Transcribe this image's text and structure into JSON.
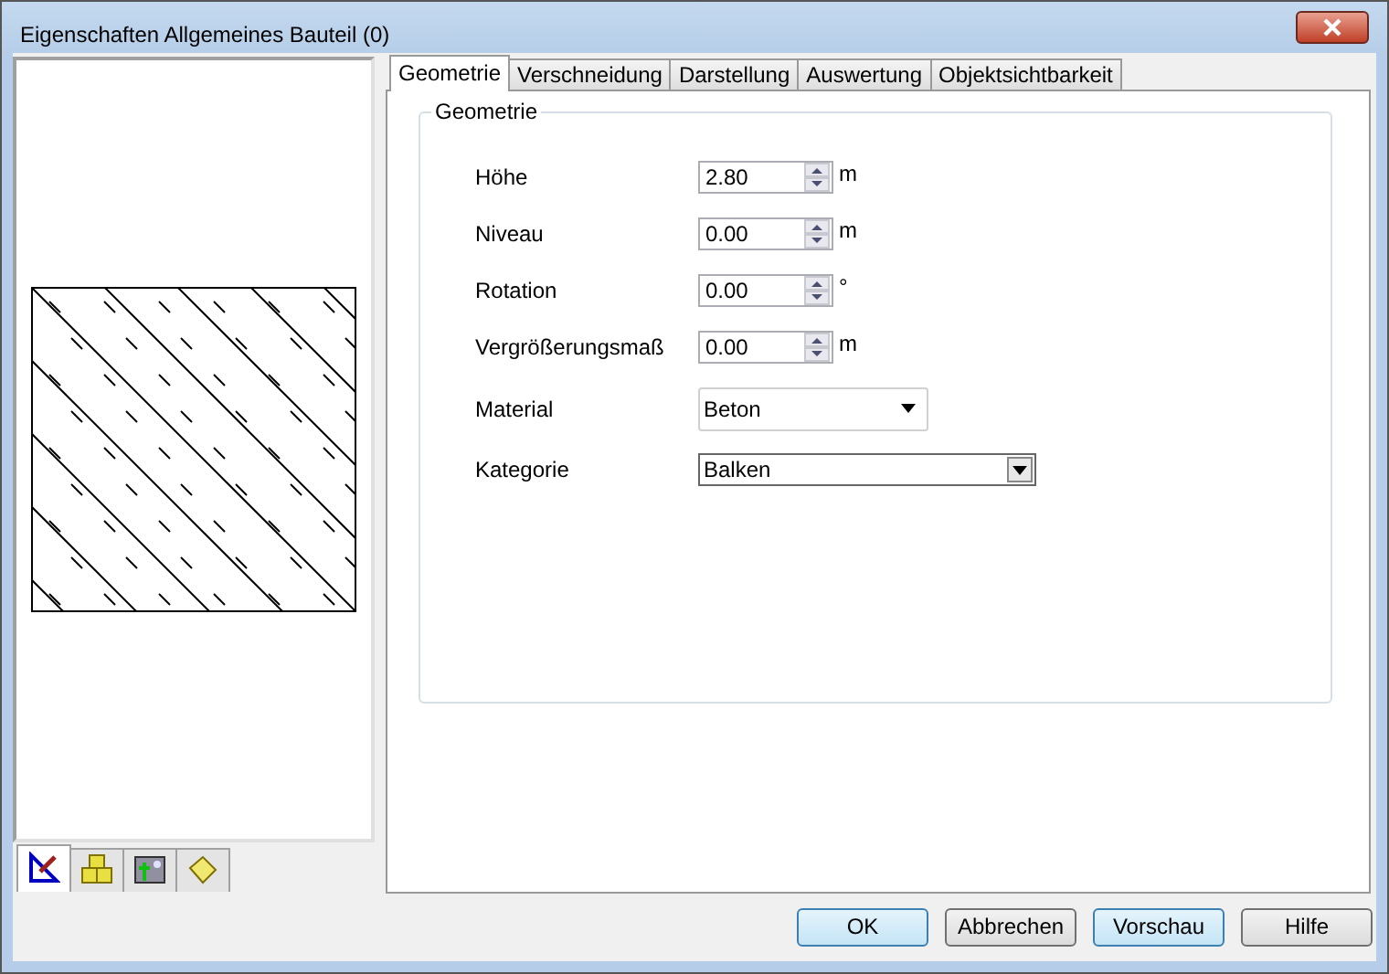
{
  "window": {
    "title": "Eigenschaften Allgemeines Bauteil (0)"
  },
  "preview_tabs": [
    {
      "selected": true
    },
    {
      "selected": false
    },
    {
      "selected": false
    },
    {
      "selected": false
    }
  ],
  "tabs": [
    {
      "label": "Geometrie",
      "selected": true
    },
    {
      "label": "Verschneidung",
      "selected": false
    },
    {
      "label": "Darstellung",
      "selected": false
    },
    {
      "label": "Auswertung",
      "selected": false
    },
    {
      "label": "Objektsichtbarkeit",
      "selected": false
    }
  ],
  "group": {
    "title": "Geometrie",
    "fields": [
      {
        "kind": "spin",
        "label": "Höhe",
        "value": "2.80",
        "unit": "m"
      },
      {
        "kind": "spin",
        "label": "Niveau",
        "value": "0.00",
        "unit": "m"
      },
      {
        "kind": "spin",
        "label": "Rotation",
        "value": "0.00",
        "unit": "°"
      },
      {
        "kind": "spin",
        "label": "Vergrößerungsmaß",
        "value": "0.00",
        "unit": "m"
      },
      {
        "kind": "dropdown",
        "label": "Material",
        "value": "Beton"
      },
      {
        "kind": "combo",
        "label": "Kategorie",
        "value": "Balken"
      }
    ]
  },
  "buttons": [
    {
      "label": "OK",
      "highlighted": true
    },
    {
      "label": "Abbrechen",
      "highlighted": false
    },
    {
      "label": "Vorschau",
      "highlighted": true
    },
    {
      "label": "Hilfe",
      "highlighted": false
    }
  ]
}
